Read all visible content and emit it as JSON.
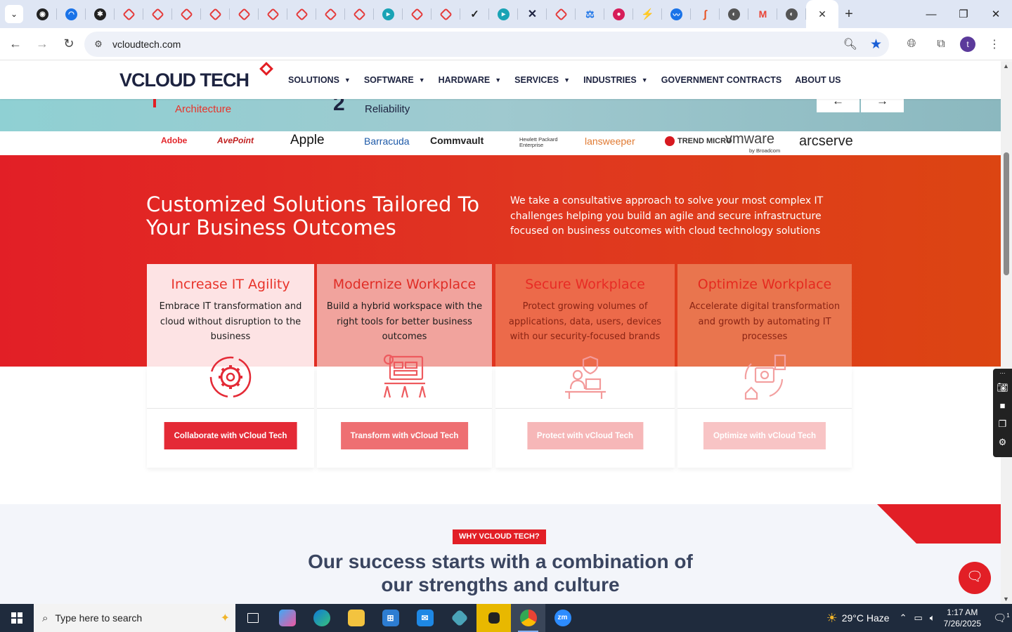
{
  "browser": {
    "tabs_count": 28,
    "url": "vcloudtech.com"
  },
  "site": {
    "logo_main": "VCLOUD",
    "logo_accent": "TECH",
    "nav": [
      {
        "label": "SOLUTIONS",
        "has_dropdown": true
      },
      {
        "label": "SOFTWARE",
        "has_dropdown": true
      },
      {
        "label": "HARDWARE",
        "has_dropdown": true
      },
      {
        "label": "SERVICES",
        "has_dropdown": true
      },
      {
        "label": "INDUSTRIES",
        "has_dropdown": true
      },
      {
        "label": "GOVERNMENT CONTRACTS",
        "has_dropdown": false
      },
      {
        "label": "ABOUT US",
        "has_dropdown": false
      }
    ]
  },
  "hero": {
    "text1": "Architecture",
    "text2": "Reliability",
    "prev_arrow": "←",
    "next_arrow": "→"
  },
  "brands": [
    "Adobe",
    "AvePoint",
    "Apple",
    "Barracuda",
    "Commvault",
    "Hewlett Packard Enterprise",
    "lansweeper",
    "TREND MICRO",
    "vmware",
    "by Broadcom",
    "arcserve"
  ],
  "solutions": {
    "title": "Customized Solutions Tailored To Your Business Outcomes",
    "description": "We take a consultative approach to solve your most complex IT challenges helping you build an agile and secure infrastructure focused on business outcomes with cloud technology solutions",
    "cards": [
      {
        "title": "Increase IT Agility",
        "description": "Embrace IT transformation and cloud without disruption to the business",
        "button": "Collaborate with vCloud Tech",
        "icon": "gear-refresh-icon"
      },
      {
        "title": "Modernize Workplace",
        "description": "Build a hybrid workspace with the right tools for better business outcomes",
        "button": "Transform with vCloud Tech",
        "icon": "workspace-icon"
      },
      {
        "title": "Secure Workplace",
        "description": "Protect growing volumes of applications, data, users, devices with our security-focused brands",
        "button": "Protect with vCloud Tech",
        "icon": "secure-desk-icon"
      },
      {
        "title": "Optimize Workplace",
        "description": "Accelerate digital transformation and growth by automating IT processes",
        "button": "Optimize with vCloud Tech",
        "icon": "automation-icon"
      }
    ]
  },
  "why": {
    "badge": "WHY VCLOUD TECH?",
    "title_line1": "Our success starts with a combination of",
    "title_line2": "our strengths and culture"
  },
  "taskbar": {
    "search_placeholder": "Type here to search",
    "weather": "29°C  Haze",
    "time": "1:17 AM",
    "date": "7/26/2025",
    "notifications": "1"
  },
  "colors": {
    "brand_red": "#e21f26",
    "navy": "#1d2340"
  }
}
